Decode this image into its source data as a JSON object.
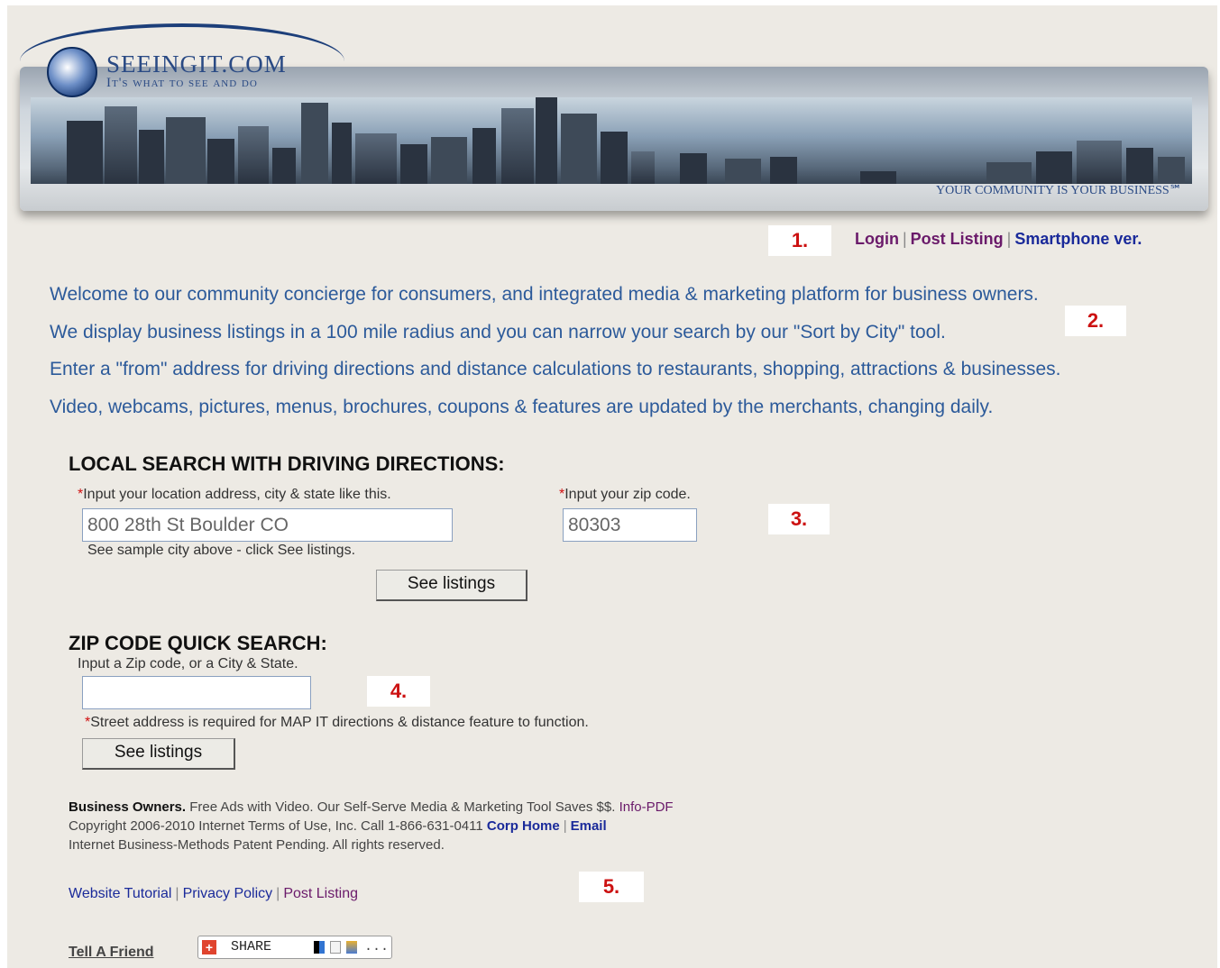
{
  "header": {
    "logo_name": "SEEINGIT.COM",
    "logo_tagline": "It's what to see and do",
    "slogan": "YOUR COMMUNITY IS YOUR BUSINESS℠"
  },
  "markers": [
    "1.",
    "2.",
    "3.",
    "4.",
    "5."
  ],
  "topnav": {
    "login": "Login",
    "sep": "|",
    "post_listing": "Post Listing",
    "smartphone": "Smartphone ver."
  },
  "intro": [
    "Welcome to our community concierge for consumers, and integrated media & marketing platform for business owners.",
    "We display business listings in a 100 mile radius and you can narrow your search by our \"Sort by City\" tool.",
    "Enter a \"from\" address for driving directions and distance calculations to restaurants, shopping, attractions & businesses.",
    "Video, webcams, pictures, menus, brochures, coupons & features are updated by the merchants, changing daily."
  ],
  "local_search": {
    "heading": "LOCAL SEARCH WITH DRIVING DIRECTIONS:",
    "required_mark": "*",
    "address_label": "Input your location address, city & state like this.",
    "address_value": "800 28th St Boulder CO",
    "zip_label": "Input your zip code.",
    "zip_value": "80303",
    "sample_note": "See sample city above - click See listings.",
    "button": "See listings"
  },
  "zip_search": {
    "heading": "ZIP CODE QUICK SEARCH:",
    "label": "Input a Zip code, or a City & State.",
    "value": "",
    "required_mark": "*",
    "note": "Street address is required for MAP IT directions & distance feature to function.",
    "button": "See listings"
  },
  "footer": {
    "biz_bold": "Business Owners.",
    "biz_text": " Free Ads with Video. Our Self-Serve Media & Marketing Tool Saves $$. ",
    "info_pdf": "Info-PDF",
    "copyright": "Copyright 2006-2010 Internet Terms of Use, Inc. Call 1-866-631-0411 ",
    "corp_home": "Corp Home",
    "email": "Email",
    "patent": "Internet Business-Methods Patent Pending. All rights reserved.",
    "link_tutorial": "Website Tutorial",
    "link_privacy": "Privacy Policy",
    "link_post": "Post Listing",
    "sep": "|",
    "tell_friend": "Tell A Friend",
    "share_label": "SHARE",
    "share_more": "..."
  },
  "colors": {
    "page_bg": "#edeae4",
    "intro_text": "#2c5a9a",
    "link_purple": "#6a1a6a",
    "link_blue": "#1a2a9a",
    "marker_red": "#cc1111"
  },
  "icons": [
    "globe-logo-icon",
    "addthis-plus-icon",
    "delicious-icon",
    "digg-icon",
    "myspace-icon"
  ]
}
